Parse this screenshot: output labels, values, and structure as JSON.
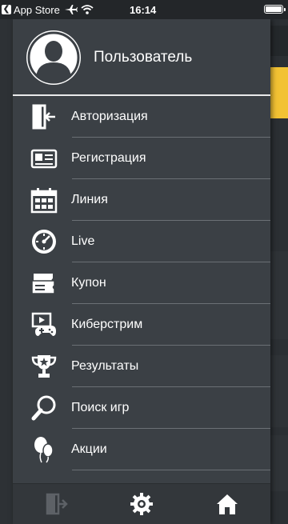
{
  "status_bar": {
    "back_app": "App Store",
    "time": "16:14"
  },
  "drawer": {
    "user_name": "Пользователь",
    "menu": [
      {
        "label": "Авторизация",
        "icon": "login-icon"
      },
      {
        "label": "Регистрация",
        "icon": "id-card-icon"
      },
      {
        "label": "Линия",
        "icon": "calendar-icon"
      },
      {
        "label": "Live",
        "icon": "stopwatch-icon"
      },
      {
        "label": "Купон",
        "icon": "tickets-icon"
      },
      {
        "label": "Киберстрим",
        "icon": "gamepad-screen-icon"
      },
      {
        "label": "Результаты",
        "icon": "trophy-icon"
      },
      {
        "label": "Поиск игр",
        "icon": "magnifier-icon"
      },
      {
        "label": "Акции",
        "icon": "balloons-icon"
      }
    ],
    "bottom_bar": [
      "login-icon",
      "settings-gear-icon",
      "home-icon"
    ]
  },
  "colors": {
    "drawer_bg": "#3b4045",
    "text": "#ffffff",
    "divider": "#6b7075",
    "background_accent": "#f2c233"
  }
}
